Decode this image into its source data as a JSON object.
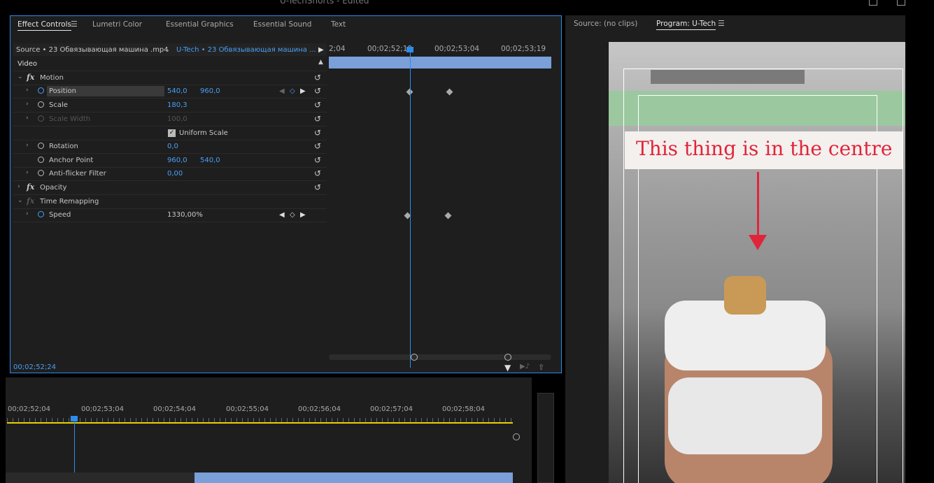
{
  "app_title": "U-TechShorts - Edited",
  "panels": {
    "effect_controls": {
      "tabs": [
        {
          "label": "Effect Controls",
          "active": true
        },
        {
          "label": "Lumetri Color"
        },
        {
          "label": "Essential Graphics"
        },
        {
          "label": "Essential Sound"
        },
        {
          "label": "Text"
        }
      ],
      "source_label": "Source • 23 Обвязывающая машина .mp4",
      "sequence_label": "U-Tech • 23 Обвязывающая машина ...",
      "section_video": "Video",
      "properties": [
        {
          "name": "Motion",
          "fx": true
        },
        {
          "name": "Position",
          "v1": "540,0",
          "v2": "960,0"
        },
        {
          "name": "Scale",
          "v1": "180,3"
        },
        {
          "name": "Scale Width",
          "v1": "100,0"
        },
        {
          "name": "Uniform Scale"
        },
        {
          "name": "Rotation",
          "v1": "0,0"
        },
        {
          "name": "Anchor Point",
          "v1": "960,0",
          "v2": "540,0"
        },
        {
          "name": "Anti-flicker Filter",
          "v1": "0,00"
        },
        {
          "name": "Opacity",
          "fx": true
        },
        {
          "name": "Time Remapping",
          "fx": true
        },
        {
          "name": "Speed",
          "v1": "1330,00%"
        }
      ],
      "timecodes": [
        "2;04",
        "00;02;52;19",
        "00;02;53;04",
        "00;02;53;19"
      ],
      "current_tc": "00;02;52;24"
    },
    "source_monitor": {
      "label": "Source: (no clips)"
    },
    "program_monitor": {
      "label": "Program: U-Tech",
      "caption": "This thing is in the centre"
    },
    "sequence": {
      "timecodes": [
        "00;02;52;04",
        "00;02;53;04",
        "00;02;54;04",
        "00;02;55;04",
        "00;02;56;04",
        "00;02;57;04",
        "00;02;58;04"
      ]
    }
  },
  "colors": {
    "accent": "#2d8ceb",
    "value_blue": "#4a9ff5",
    "caption_red": "#e0253a",
    "work_area_yellow": "#e6d200"
  }
}
